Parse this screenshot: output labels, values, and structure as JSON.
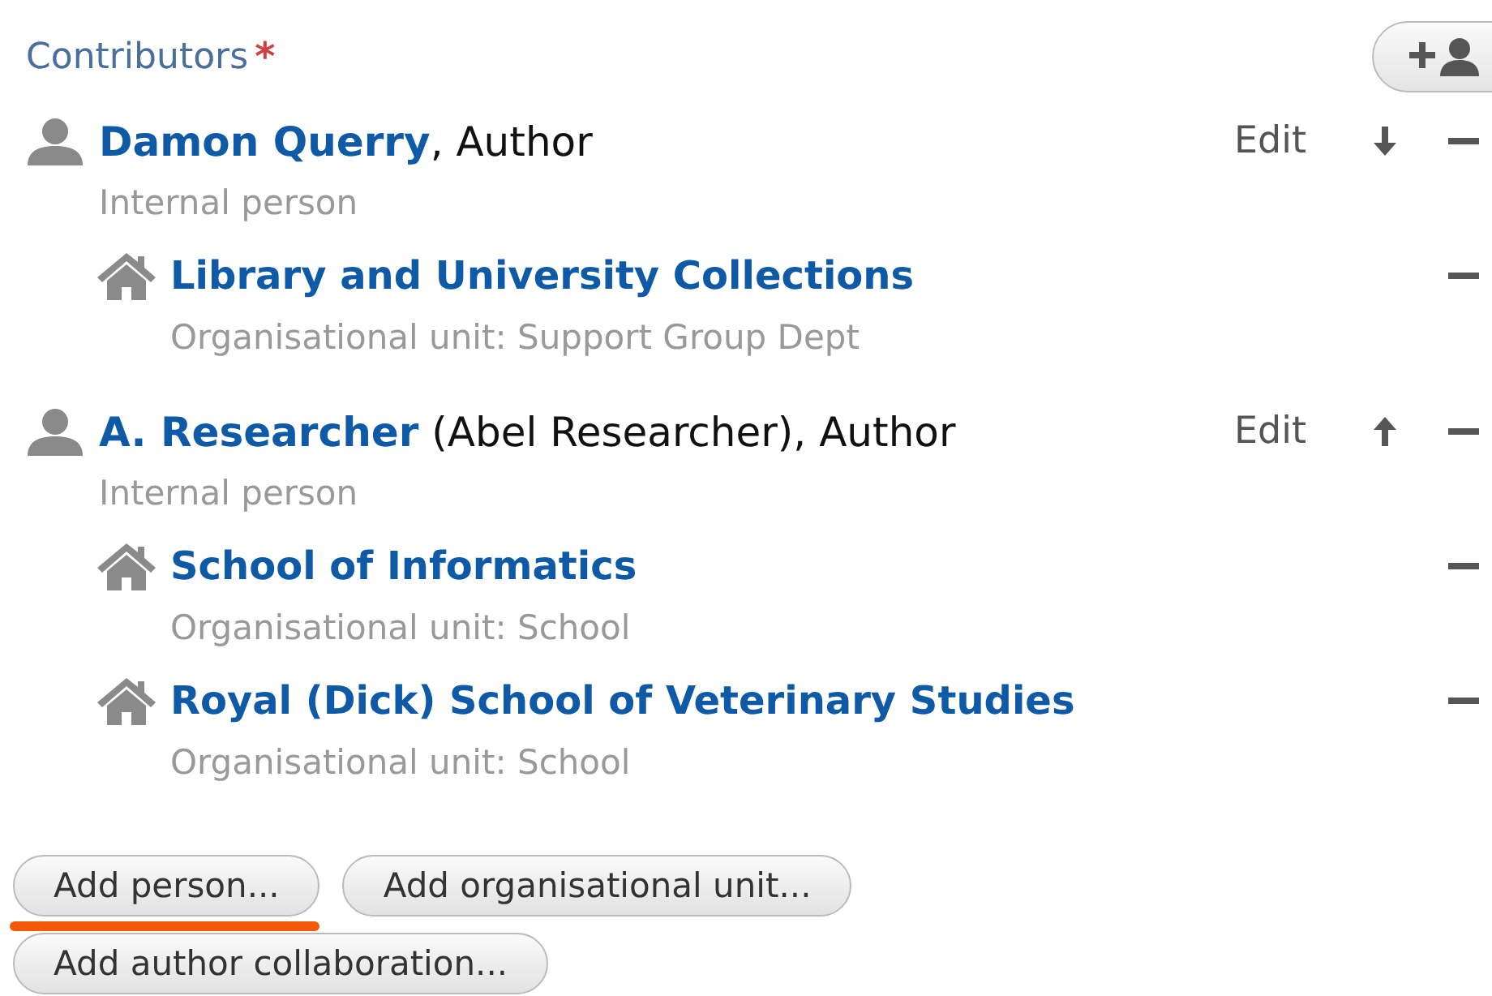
{
  "section": {
    "title": "Contributors",
    "required_mark": "*"
  },
  "persons": [
    {
      "name": "Damon Querry",
      "detail": ", Author",
      "edit_label": "Edit",
      "type": "Internal person",
      "move_up": false,
      "move_down": true,
      "units": [
        {
          "name": "Library and University Collections",
          "type": "Organisational unit: Support Group Dept"
        }
      ]
    },
    {
      "name": "A. Researcher",
      "detail": " (Abel Researcher), Author",
      "edit_label": "Edit",
      "type": "Internal person",
      "move_up": true,
      "move_down": false,
      "units": [
        {
          "name": "School of Informatics",
          "type": "Organisational unit: School"
        },
        {
          "name": "Royal (Dick) School of Veterinary Studies",
          "type": "Organisational unit: School"
        }
      ]
    }
  ],
  "buttons": [
    {
      "label": "Add person...",
      "highlighted": true
    },
    {
      "label": "Add organisational unit...",
      "highlighted": false
    },
    {
      "label": "Add author collaboration...",
      "highlighted": false
    }
  ]
}
